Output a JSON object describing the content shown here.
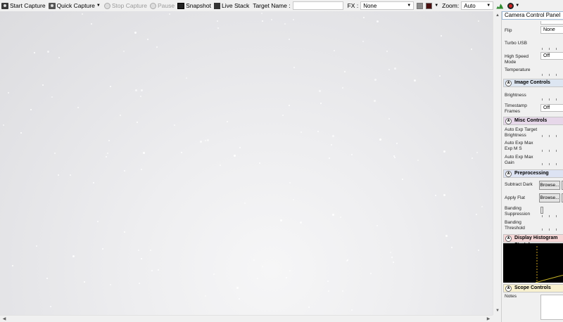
{
  "toolbar": {
    "start_capture": "Start Capture",
    "quick_capture": "Quick Capture",
    "stop_capture": "Stop Capture",
    "pause": "Pause",
    "snapshot": "Snapshot",
    "live_stack": "Live Stack",
    "target_name_label": "Target Name :",
    "target_name_value": "",
    "fx_label": "FX :",
    "fx_value": "None",
    "zoom_label": "Zoom:",
    "zoom_value": "Auto",
    "swatch_colors": [
      "#8c8c8c",
      "#4a0f0f"
    ]
  },
  "panel": {
    "title": "Camera Control Panel",
    "camera_rows": {
      "flip_label": "Flip",
      "flip_value": "None",
      "turbo_usb_label": "Turbo USB",
      "high_speed_label": "High Speed Mode",
      "high_speed_value": "Off",
      "temperature_label": "Temperature"
    },
    "image_controls": {
      "header": "Image Controls",
      "brightness_label": "Brightness",
      "timestamp_label": "Timestamp Frames",
      "timestamp_value": "Off"
    },
    "misc_controls": {
      "header": "Misc Controls",
      "auto_exp_target_label": "Auto Exp Target Brightness",
      "auto_exp_max_ms_label": "Auto Exp Max Exp M S",
      "auto_exp_max_gain_label": "Auto Exp Max Gain"
    },
    "preprocessing": {
      "header": "Preprocessing",
      "subtract_dark_label": "Subtract Dark",
      "apply_flat_label": "Apply Flat",
      "browse_label": "Browse...",
      "banding_suppression_label": "Banding Suppression",
      "banding_threshold_label": "Banding Threshold"
    },
    "histogram": {
      "header": "Display Histogram Stretch"
    },
    "scope_controls": {
      "header": "Scope Controls",
      "notes_label": "Notes"
    }
  },
  "colors": {
    "histogram_bg": "#000000",
    "histogram_line": "#c8b428",
    "histogram_marker": "#c8a020"
  }
}
